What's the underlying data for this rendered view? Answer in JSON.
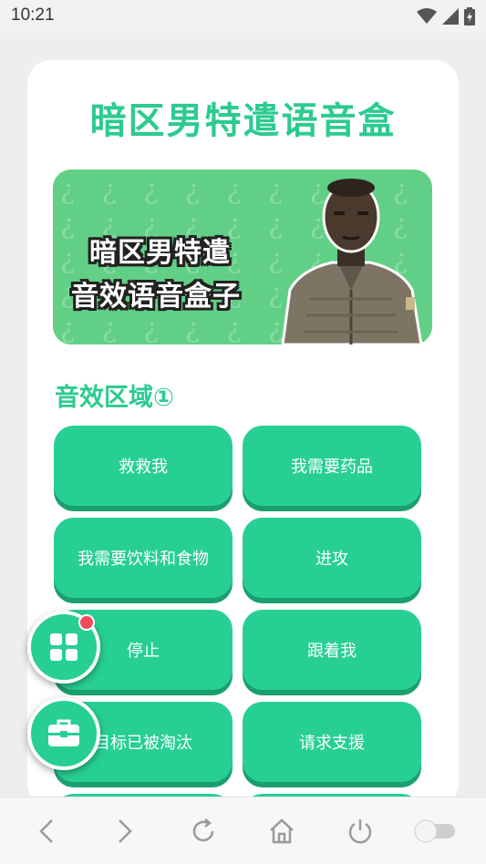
{
  "status_bar": {
    "time": "10:21"
  },
  "app": {
    "title": "暗区男特遣语音盒"
  },
  "banner": {
    "line1": "暗区男特遣",
    "line2": "音效语音盒子"
  },
  "section": {
    "title": "音效区域①"
  },
  "buttons": [
    "救救我",
    "我需要药品",
    "我需要饮料和食物",
    "进攻",
    "停止",
    "跟着我",
    "目标已被淘汰",
    "请求支援",
    "",
    ""
  ],
  "colors": {
    "accent": "#27cf93",
    "title": "#2ccb8f",
    "badge": "#f24b5b"
  },
  "icons": {
    "fab_top": "grid-icon",
    "fab_bottom": "toolbox-icon",
    "nav": [
      "back-icon",
      "forward-icon",
      "refresh-icon",
      "home-icon",
      "power-icon",
      "toggle-icon"
    ]
  }
}
